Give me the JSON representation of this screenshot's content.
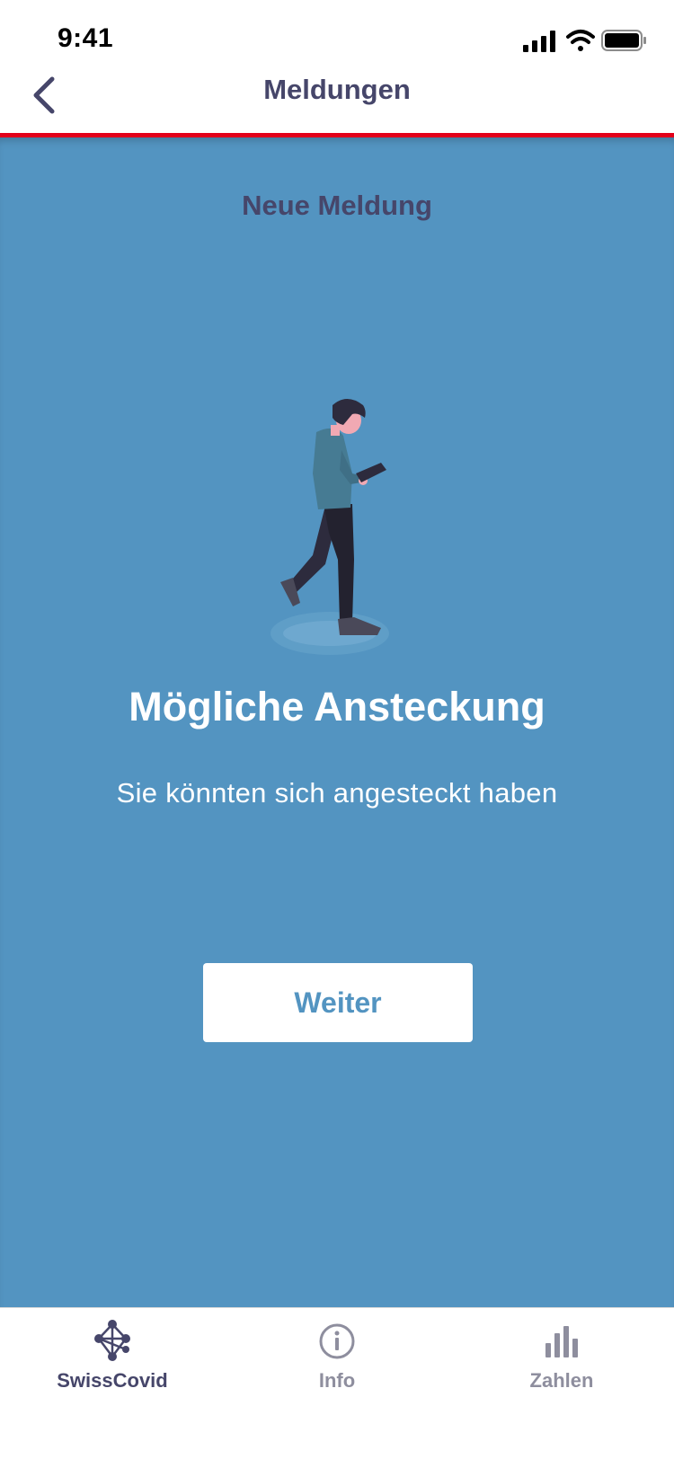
{
  "status_bar": {
    "time": "9:41",
    "icons": [
      "cellular-signal-icon",
      "wifi-icon",
      "battery-icon"
    ]
  },
  "header": {
    "back_icon": "chevron-left-icon",
    "title": "Meldungen"
  },
  "content": {
    "section_title": "Neue Meldung",
    "illustration": "person-walking-with-phone",
    "headline": "Mögliche Ansteckung",
    "subtext": "Sie könnten sich angesteckt haben",
    "button_label": "Weiter"
  },
  "tabs": [
    {
      "label": "SwissCovid",
      "icon": "network-icon",
      "active": true
    },
    {
      "label": "Info",
      "icon": "info-icon",
      "active": false
    },
    {
      "label": "Zahlen",
      "icon": "bar-chart-icon",
      "active": false
    }
  ],
  "colors": {
    "accent_red": "#e2001a",
    "content_blue": "#5394c1",
    "title_navy": "#46466a",
    "inactive_gray": "#8e8e9e"
  }
}
